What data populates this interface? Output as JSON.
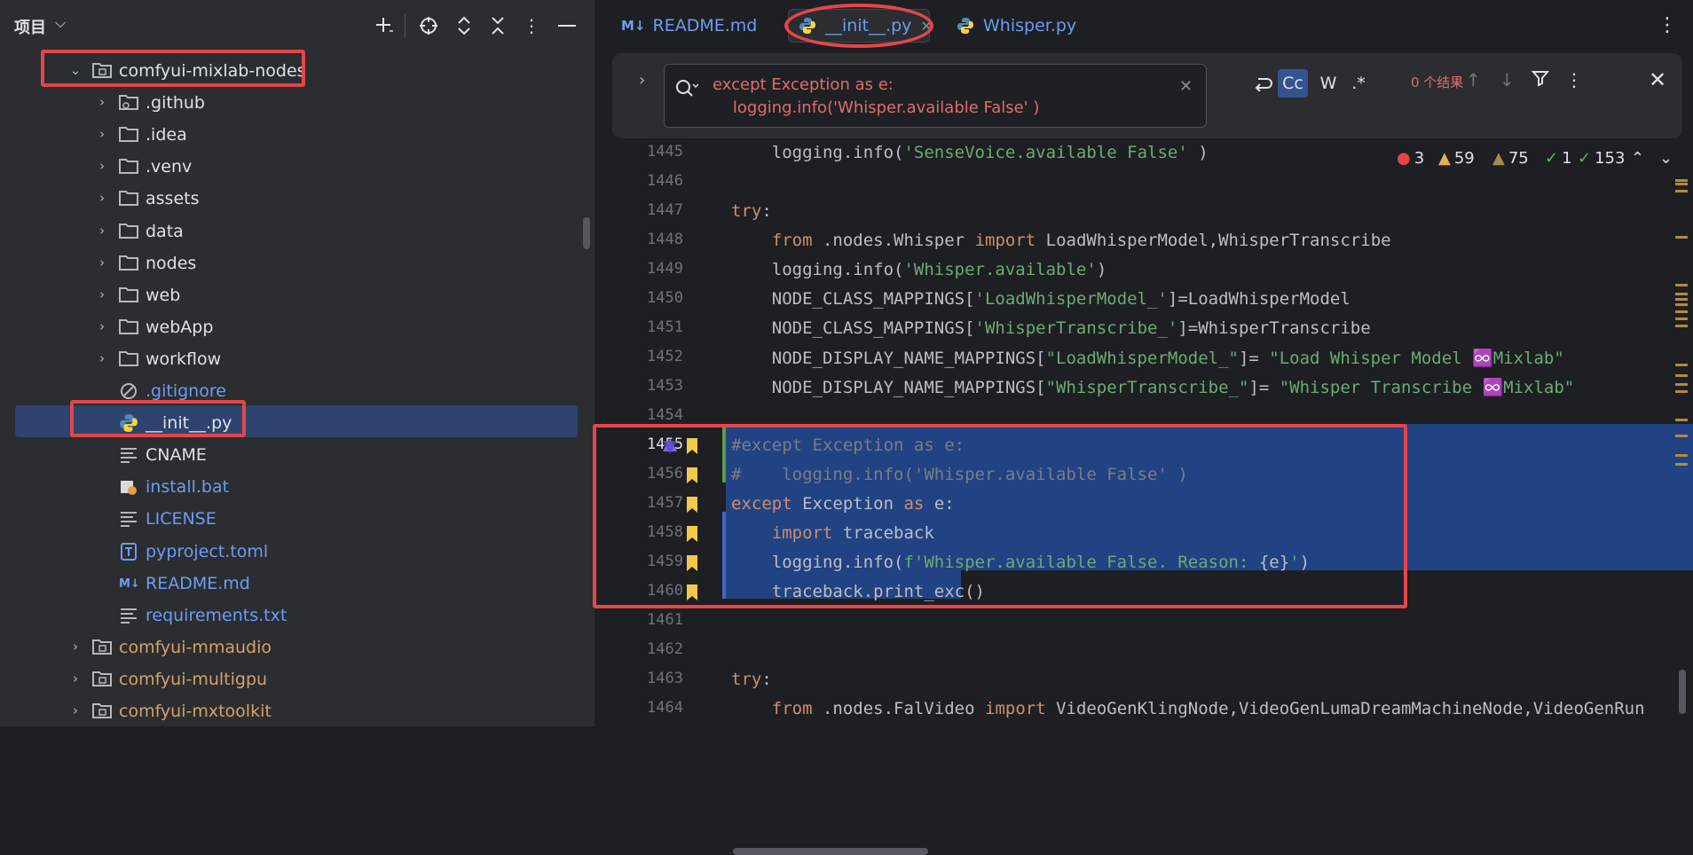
{
  "project": {
    "title": "项目",
    "tree": [
      {
        "label": "comfyui-mixlab-nodes",
        "kind": "folder",
        "expanded": true,
        "indent": 0,
        "color": "default"
      },
      {
        "label": ".github",
        "kind": "folder-git",
        "expanded": false,
        "indent": 1,
        "color": "default"
      },
      {
        "label": ".idea",
        "kind": "folder",
        "expanded": false,
        "indent": 1,
        "color": "default"
      },
      {
        "label": ".venv",
        "kind": "folder",
        "expanded": false,
        "indent": 1,
        "color": "default"
      },
      {
        "label": "assets",
        "kind": "folder",
        "expanded": false,
        "indent": 1,
        "color": "default"
      },
      {
        "label": "data",
        "kind": "folder",
        "expanded": false,
        "indent": 1,
        "color": "default"
      },
      {
        "label": "nodes",
        "kind": "folder",
        "expanded": false,
        "indent": 1,
        "color": "default"
      },
      {
        "label": "web",
        "kind": "folder",
        "expanded": false,
        "indent": 1,
        "color": "default"
      },
      {
        "label": "webApp",
        "kind": "folder",
        "expanded": false,
        "indent": 1,
        "color": "default"
      },
      {
        "label": "workflow",
        "kind": "folder",
        "expanded": false,
        "indent": 1,
        "color": "default"
      },
      {
        "label": ".gitignore",
        "kind": "ignore",
        "indent": 1,
        "color": "blue"
      },
      {
        "label": "__init__.py",
        "kind": "python",
        "indent": 1,
        "color": "default",
        "selected": true
      },
      {
        "label": "CNAME",
        "kind": "text",
        "indent": 1,
        "color": "default"
      },
      {
        "label": "install.bat",
        "kind": "bat",
        "indent": 1,
        "color": "blue"
      },
      {
        "label": "LICENSE",
        "kind": "text",
        "indent": 1,
        "color": "blue"
      },
      {
        "label": "pyproject.toml",
        "kind": "toml",
        "indent": 1,
        "color": "blue"
      },
      {
        "label": "README.md",
        "kind": "markdown",
        "indent": 1,
        "color": "blue"
      },
      {
        "label": "requirements.txt",
        "kind": "text",
        "indent": 1,
        "color": "blue"
      },
      {
        "label": "comfyui-mmaudio",
        "kind": "folder",
        "expanded": false,
        "indent": 0,
        "color": "orange"
      },
      {
        "label": "comfyui-multigpu",
        "kind": "folder",
        "expanded": false,
        "indent": 0,
        "color": "orange"
      },
      {
        "label": "comfyui-mxtoolkit",
        "kind": "folder",
        "expanded": false,
        "indent": 0,
        "color": "orange"
      }
    ]
  },
  "tabs": [
    {
      "label": "README.md",
      "icon": "markdown-icon",
      "active": false
    },
    {
      "label": "__init__.py",
      "icon": "python-icon",
      "active": true
    },
    {
      "label": "Whisper.py",
      "icon": "python-icon",
      "active": false
    }
  ],
  "search": {
    "line1": "except Exception as e:",
    "line2": "    logging.info('Whisper.available False' )",
    "results": "0 个结果",
    "opt_case": "Cc",
    "opt_word": "W",
    "opt_regex": ".*"
  },
  "inspections": {
    "errors": "3",
    "warnings": "59",
    "weak_warnings": "75",
    "typos": "1",
    "ok": "153"
  },
  "code": [
    {
      "num": "1445",
      "html": "    logging.info(<s>'SenseVoice.available False'</s> )"
    },
    {
      "num": "1446",
      "html": ""
    },
    {
      "num": "1447",
      "html": "<k>try</k>:"
    },
    {
      "num": "1448",
      "html": "    <k>from</k> .nodes.Whisper <k>import</k> LoadWhisperModel,WhisperTranscribe"
    },
    {
      "num": "1449",
      "html": "    logging.info(<s>'Whisper.available'</s>)"
    },
    {
      "num": "1450",
      "html": "    NODE_CLASS_MAPPINGS[<s>'LoadWhisperModel_'</s>]=LoadWhisperModel"
    },
    {
      "num": "1451",
      "html": "    NODE_CLASS_MAPPINGS[<s>'WhisperTranscribe_'</s>]=WhisperTranscribe"
    },
    {
      "num": "1452",
      "html": "    NODE_DISPLAY_NAME_MAPPINGS[<s>\"LoadWhisperModel_\"</s>]= <s>\"Load Whisper Model ♾️Mixlab\"</s>"
    },
    {
      "num": "1453",
      "html": "    NODE_DISPLAY_NAME_MAPPINGS[<s>\"WhisperTranscribe_\"</s>]= <s>\"Whisper Transcribe ♾️Mixlab\"</s>"
    },
    {
      "num": "1454",
      "html": ""
    },
    {
      "num": "1455",
      "html": "<c>#except Exception as e:</c>"
    },
    {
      "num": "1456",
      "html": "<c>#    logging.info('Whisper.available False' )</c>"
    },
    {
      "num": "1457",
      "html": "<k>except</k> Exception <k>as</k> e:"
    },
    {
      "num": "1458",
      "html": "    <k>import</k> traceback"
    },
    {
      "num": "1459",
      "html": "    logging.info(<s>f'Whisper.available False. Reason: </s>{e}<s>'</s>)"
    },
    {
      "num": "1460",
      "html": "    traceback.print_exc()"
    },
    {
      "num": "1461",
      "html": ""
    },
    {
      "num": "1462",
      "html": ""
    },
    {
      "num": "1463",
      "html": "<k>try</k>:"
    },
    {
      "num": "1464",
      "html": "    <k>from</k> .nodes.FalVideo <k>import</k> VideoGenKlingNode,VideoGenLumaDreamMachineNode,VideoGenRun"
    }
  ],
  "colors": {
    "accent": "#35538f",
    "selection": "#214283",
    "highlight": "#e5464a",
    "keyword": "#cf8e6d",
    "string": "#6aab73"
  }
}
